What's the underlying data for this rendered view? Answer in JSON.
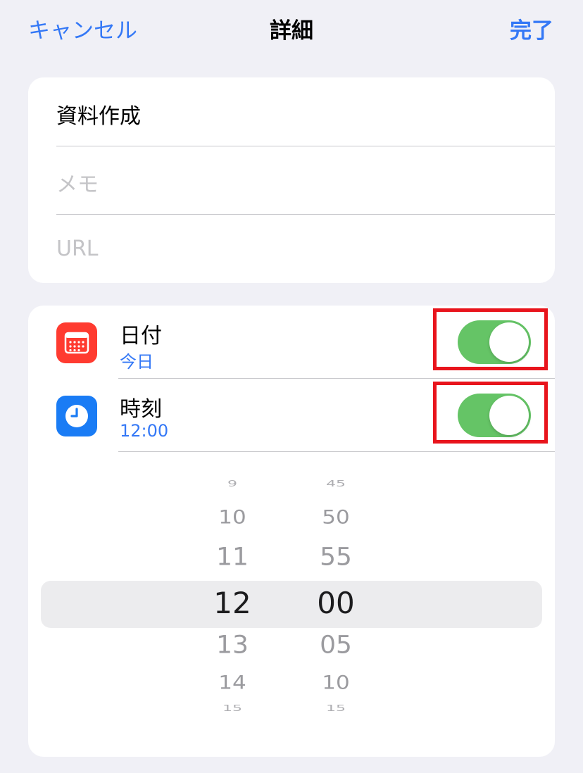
{
  "nav": {
    "cancel_label": "キャンセル",
    "title": "詳細",
    "done_label": "完了"
  },
  "fields": {
    "title_value": "資料作成",
    "memo_placeholder": "メモ",
    "url_placeholder": "URL"
  },
  "date_row": {
    "label": "日付",
    "value": "今日",
    "icon": "calendar-icon",
    "enabled": true
  },
  "time_row": {
    "label": "時刻",
    "value": "12:00",
    "icon": "clock-icon",
    "enabled": true
  },
  "picker": {
    "hours": [
      "9",
      "10",
      "11",
      "12",
      "13",
      "14",
      "15"
    ],
    "minutes": [
      "45",
      "50",
      "55",
      "00",
      "05",
      "10",
      "15"
    ],
    "selected_hour": "12",
    "selected_minute": "00"
  },
  "colors": {
    "accent": "#3478f6",
    "toggle_on": "#65c466",
    "calendar_icon_bg": "#ff3b30",
    "clock_icon_bg": "#1a7cf5",
    "highlight_box": "#e8141c"
  }
}
